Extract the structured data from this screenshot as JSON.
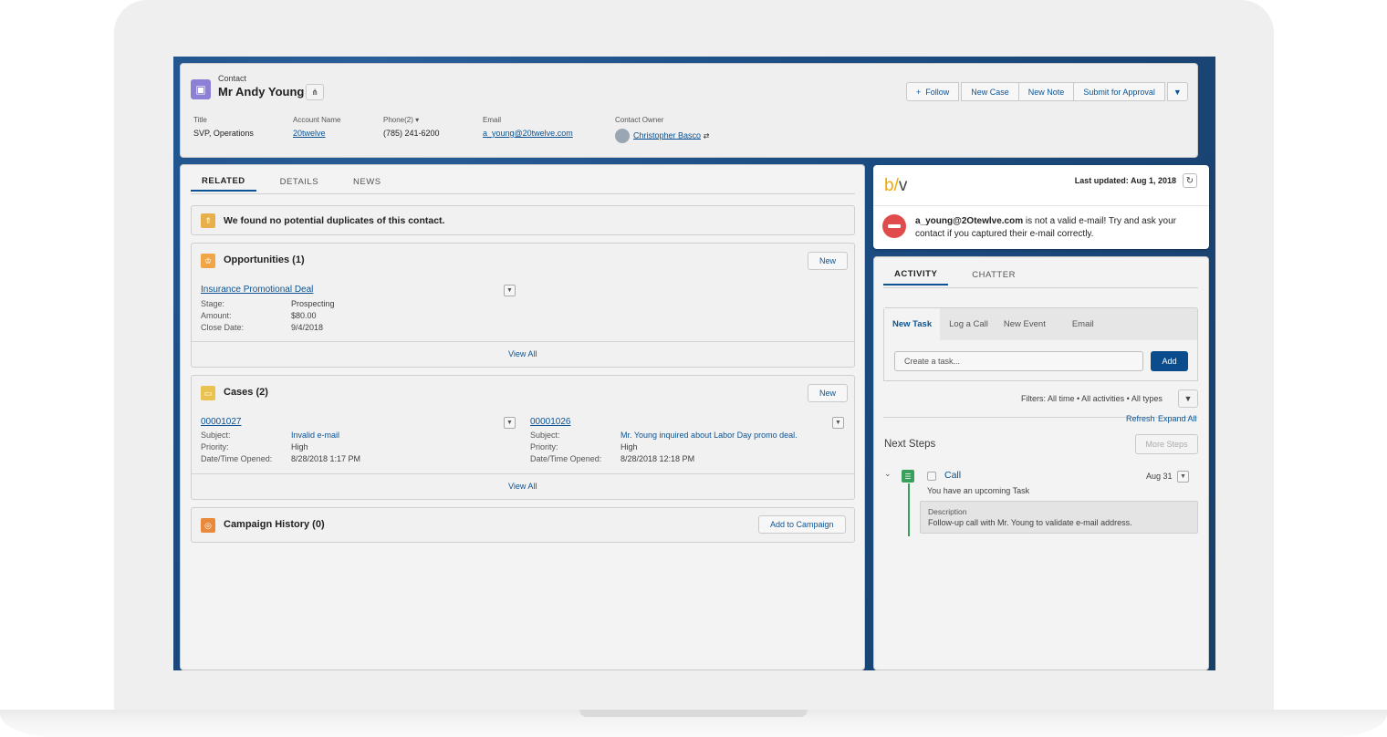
{
  "contact": {
    "object_type": "Contact",
    "name": "Mr Andy Young",
    "actions": {
      "follow": "Follow",
      "new_case": "New Case",
      "new_note": "New Note",
      "submit": "Submit for Approval"
    },
    "fields": {
      "title_label": "Title",
      "title_value": "SVP, Operations",
      "account_label": "Account Name",
      "account_value": "20twelve",
      "phone_label": "Phone(2)",
      "phone_value": "(785) 241-6200",
      "email_label": "Email",
      "email_value": "a_young@20twelve.com",
      "owner_label": "Contact Owner",
      "owner_value": "Christopher Basco"
    }
  },
  "left_tabs": [
    "RELATED",
    "DETAILS",
    "NEWS"
  ],
  "duplicates_msg": "We found no potential duplicates of this contact.",
  "opportunities": {
    "title": "Opportunities (1)",
    "new": "New",
    "record": {
      "name": "Insurance Promotional Deal",
      "stage_label": "Stage:",
      "stage": "Prospecting",
      "amount_label": "Amount:",
      "amount": "$80.00",
      "close_label": "Close Date:",
      "close": "9/4/2018"
    },
    "view_all": "View All"
  },
  "cases": {
    "title": "Cases (2)",
    "new": "New",
    "records": [
      {
        "number": "00001027",
        "subject_label": "Subject:",
        "subject": "Invalid e-mail",
        "priority_label": "Priority:",
        "priority": "High",
        "opened_label": "Date/Time Opened:",
        "opened": "8/28/2018 1:17 PM"
      },
      {
        "number": "00001026",
        "subject_label": "Subject:",
        "subject": "Mr. Young inquired about Labor Day promo deal.",
        "priority_label": "Priority:",
        "priority": "High",
        "opened_label": "Date/Time Opened:",
        "opened": "8/28/2018 12:18 PM"
      }
    ],
    "view_all": "View All"
  },
  "campaign": {
    "title": "Campaign History (0)",
    "add": "Add to Campaign"
  },
  "bv": {
    "logo_b": "b",
    "logo_slash": "/",
    "logo_v": "v",
    "updated": "Last updated: Aug 1, 2018",
    "email": "a_young@2Otewlve.com",
    "message": " is not a valid e-mail! Try and ask your contact if you captured their e-mail correctly."
  },
  "right_tabs": [
    "ACTIVITY",
    "CHATTER"
  ],
  "activity": {
    "subtabs": [
      "New Task",
      "Log a Call",
      "New Event",
      "Email"
    ],
    "task_placeholder": "Create a task...",
    "add": "Add",
    "filters": "Filters: All time • All activities • All types",
    "refresh": "Refresh",
    "expand_all": "Expand All",
    "next_steps": "Next Steps",
    "more_steps": "More Steps",
    "item": {
      "title": "Call",
      "date": "Aug 31",
      "subtitle": "You have an upcoming Task",
      "desc_label": "Description",
      "desc": "Follow-up call with Mr. Young to validate e-mail address."
    }
  },
  "colors": {
    "brand_blue": "#0b5394",
    "add_button": "#0b4c8c",
    "error_red": "#e04b4b",
    "task_green": "#3a9f5a",
    "contact_icon": "#8b7fd6"
  }
}
